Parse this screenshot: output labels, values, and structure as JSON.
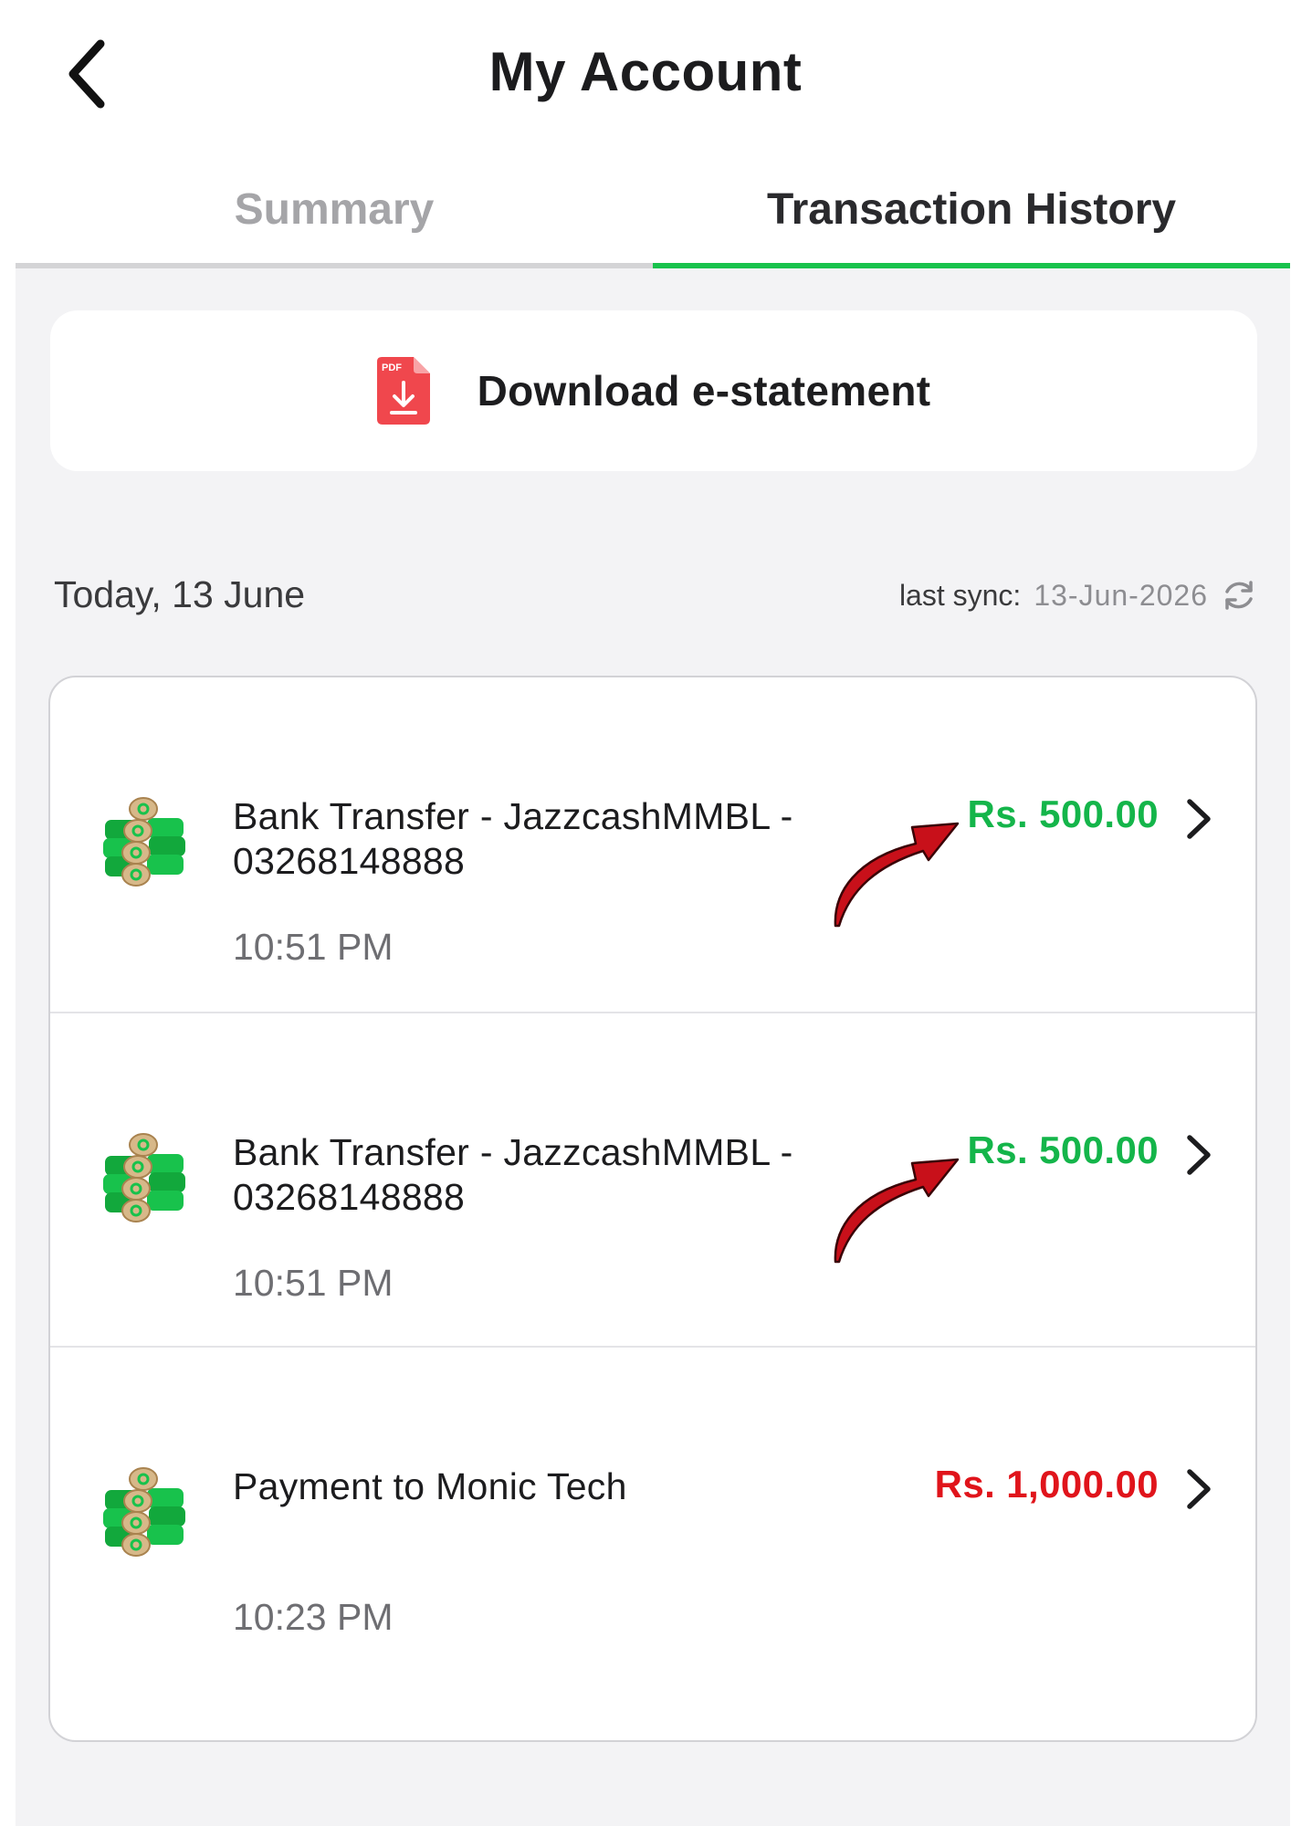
{
  "header": {
    "title": "My Account",
    "back_icon": "chevron-left-icon"
  },
  "tabs": [
    {
      "label": "Summary",
      "active": false
    },
    {
      "label": "Transaction History",
      "active": true
    }
  ],
  "colors": {
    "accent_green": "#18c24c",
    "credit_green": "#14b54a",
    "debit_red": "#e0141b",
    "pdf_red": "#f0474d",
    "annotation_red": "#c8101a"
  },
  "download": {
    "label": "Download e-statement",
    "icon": "pdf-download-icon",
    "icon_text": "PDF"
  },
  "date_header": {
    "date": "Today, 13 June",
    "sync_label": "last sync:",
    "sync_date": "13-Jun-2026",
    "sync_icon": "refresh-icon"
  },
  "transactions": [
    {
      "description": "Bank Transfer - JazzcashMMBL - 03268148888",
      "time": "10:51 PM",
      "amount": "Rs. 500.00",
      "type": "credit",
      "icon": "coins-icon",
      "annotated": true
    },
    {
      "description": "Bank Transfer - JazzcashMMBL - 03268148888",
      "time": "10:51 PM",
      "amount": "Rs. 500.00",
      "type": "credit",
      "icon": "coins-icon",
      "annotated": true
    },
    {
      "description": "Payment to Monic Tech",
      "time": "10:23 PM",
      "amount": "Rs. 1,000.00",
      "type": "debit",
      "icon": "coins-icon",
      "annotated": false
    }
  ]
}
